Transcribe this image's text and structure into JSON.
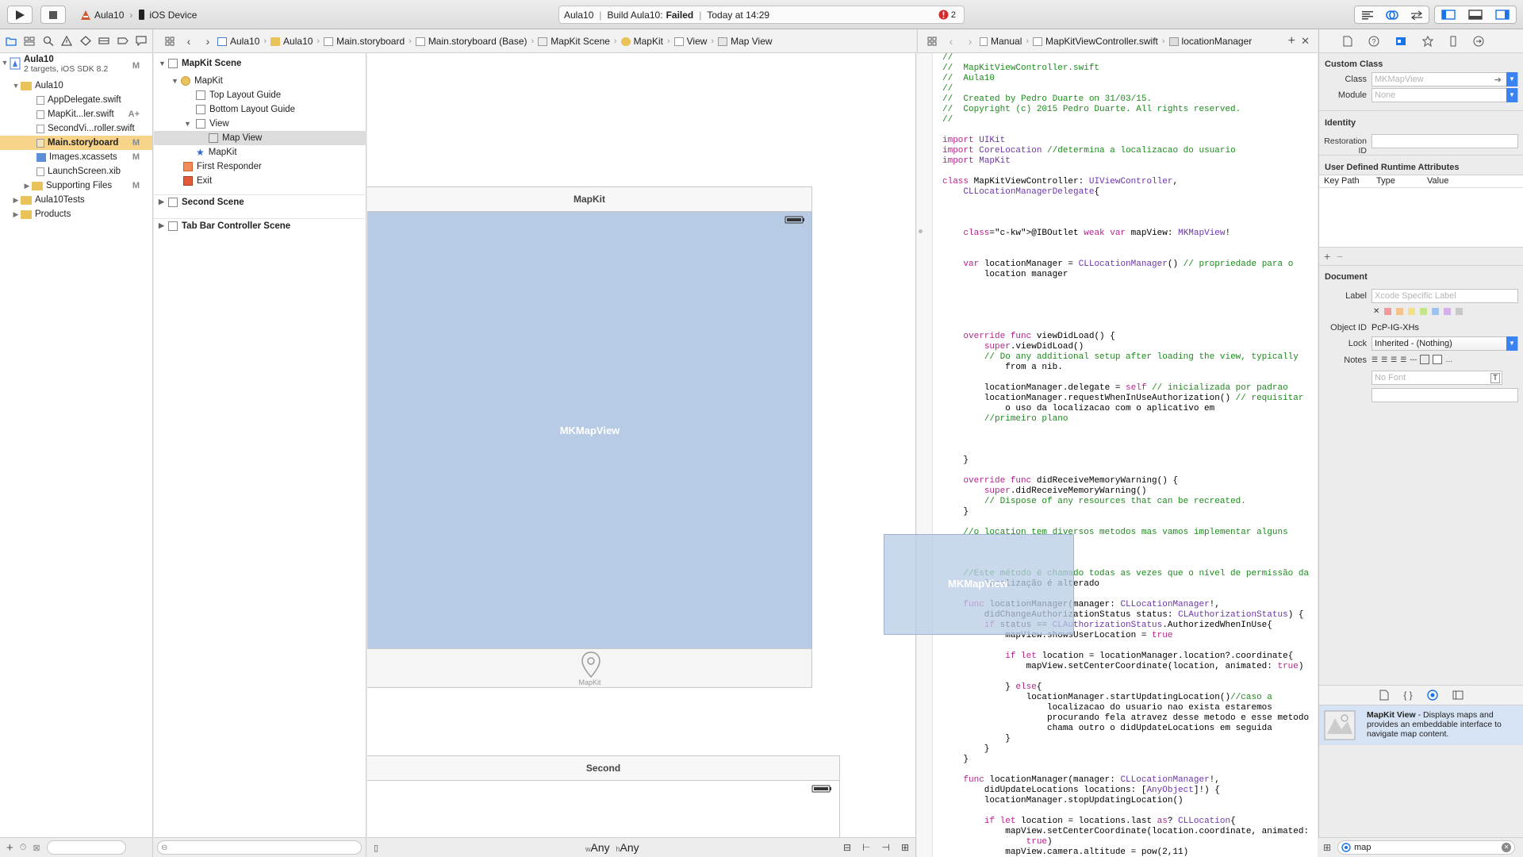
{
  "toolbar": {
    "scheme_name": "Aula10",
    "device_name": "iOS Device",
    "activity_project": "Aula10",
    "activity_prefix": "Build Aula10:",
    "activity_status": "Failed",
    "activity_time": "Today at 14:29",
    "error_count": "2"
  },
  "jumpbar": {
    "items": [
      "Aula10",
      "Aula10",
      "Main.storyboard",
      "Main.storyboard (Base)",
      "MapKit Scene",
      "MapKit",
      "View",
      "Map View"
    ]
  },
  "assistant_jumpbar": {
    "mode": "Manual",
    "file": "MapKitViewController.swift",
    "symbol": "locationManager"
  },
  "navigator": {
    "project_name": "Aula10",
    "project_subtitle": "2 targets, iOS SDK 8.2",
    "project_badge": "M",
    "items": [
      {
        "label": "Aula10",
        "badge": ""
      },
      {
        "label": "AppDelegate.swift",
        "badge": ""
      },
      {
        "label": "MapKit...ler.swift",
        "badge": "A+"
      },
      {
        "label": "SecondVi...roller.swift",
        "badge": ""
      },
      {
        "label": "Main.storyboard",
        "badge": "M"
      },
      {
        "label": "Images.xcassets",
        "badge": "M"
      },
      {
        "label": "LaunchScreen.xib",
        "badge": ""
      },
      {
        "label": "Supporting Files",
        "badge": "M"
      },
      {
        "label": "Aula10Tests",
        "badge": ""
      },
      {
        "label": "Products",
        "badge": ""
      }
    ]
  },
  "outline": {
    "items": [
      "MapKit Scene",
      "MapKit",
      "Top Layout Guide",
      "Bottom Layout Guide",
      "View",
      "Map View",
      "MapKit",
      "First Responder",
      "Exit",
      "Second Scene",
      "Tab Bar Controller Scene"
    ]
  },
  "canvas": {
    "scene1_title": "MapKit",
    "mapview_label": "MKMapView",
    "tab_label": "MapKit",
    "scene2_title": "Second",
    "drag_label": "MKMapView",
    "size_w_prefix": "w",
    "size_w": "Any",
    "size_h_prefix": "h",
    "size_h": "Any"
  },
  "inspector": {
    "custom_class_header": "Custom Class",
    "class_label": "Class",
    "class_placeholder": "MKMapView",
    "module_label": "Module",
    "module_placeholder": "None",
    "identity_header": "Identity",
    "restoration_label": "Restoration ID",
    "runtime_header": "User Defined Runtime Attributes",
    "col_keypath": "Key Path",
    "col_type": "Type",
    "col_value": "Value",
    "document_header": "Document",
    "label_label": "Label",
    "label_placeholder": "Xcode Specific Label",
    "objectid_label": "Object ID",
    "objectid_value": "PcP-IG-XHs",
    "lock_label": "Lock",
    "lock_value": "Inherited - (Nothing)",
    "notes_label": "Notes",
    "font_placeholder": "No Font",
    "library_title": "MapKit View",
    "library_desc": " - Displays maps and provides an embeddable interface to navigate map content.",
    "search_value": "map"
  },
  "code_lines": [
    "//",
    "//  MapKitViewController.swift",
    "//  Aula10",
    "//",
    "//  Created by Pedro Duarte on 31/03/15.",
    "//  Copyright (c) 2015 Pedro Duarte. All rights reserved.",
    "//",
    "",
    "import UIKit",
    "import CoreLocation //determina a localizacao do usuario",
    "import MapKit",
    "",
    "class MapKitViewController: UIViewController,",
    "    CLLocationManagerDelegate{",
    "",
    "",
    "",
    "    @IBOutlet weak var mapView: MKMapView!",
    "",
    "",
    "    var locationManager = CLLocationManager() // propriedade para o",
    "        location manager",
    "",
    "",
    "",
    "",
    "",
    "    override func viewDidLoad() {",
    "        super.viewDidLoad()",
    "        // Do any additional setup after loading the view, typically",
    "            from a nib.",
    "",
    "        locationManager.delegate = self // inicializada por padrao",
    "        locationManager.requestWhenInUseAuthorization() // requisitar",
    "            o uso da localizacao com o aplicativo em",
    "        //primeiro plano",
    "",
    "",
    "",
    "    }",
    "",
    "    override func didReceiveMemoryWarning() {",
    "        super.didReceiveMemoryWarning()",
    "        // Dispose of any resources that can be recreated.",
    "    }",
    "",
    "    //o location tem diversos metodos mas vamos implementar alguns",
    "",
    "",
    "",
    "    //Este método é chamado todas as vezes que o nível de permissão da",
    "        localização é alterado",
    "",
    "    func locationManager(manager: CLLocationManager!,",
    "        didChangeAuthorizationStatus status: CLAuthorizationStatus) {",
    "        if status == CLAuthorizationStatus.AuthorizedWhenInUse{",
    "            mapView.showsUserLocation = true",
    "",
    "            if let location = locationManager.location?.coordinate{",
    "                mapView.setCenterCoordinate(location, animated: true)",
    "",
    "            } else{",
    "                locationManager.startUpdatingLocation()//caso a",
    "                    localizacao do usuario nao exista estaremos",
    "                    procurando fela atravez desse metodo e esse metodo",
    "                    chama outro o didUpdateLocations em seguida",
    "            }",
    "        }",
    "    }",
    "",
    "    func locationManager(manager: CLLocationManager!,",
    "        didUpdateLocations locations: [AnyObject]!) {",
    "        locationManager.stopUpdatingLocation()",
    "",
    "        if let location = locations.last as? CLLocation{",
    "            mapView.setCenterCoordinate(location.coordinate, animated:",
    "                true)",
    "            mapView.camera.altitude = pow(2,11)",
    "        }"
  ],
  "colors": {
    "selection": "#f7d48a",
    "map_fill": "#b8cbe4",
    "error_red": "#d42a2a"
  }
}
